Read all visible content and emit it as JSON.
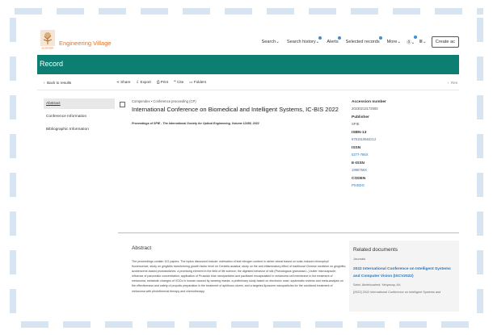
{
  "header": {
    "brand": "Engineering Village",
    "nav": [
      {
        "label": "Search",
        "chev": "⌄"
      },
      {
        "label": "Search history",
        "chev": "⌄",
        "dot": true
      },
      {
        "label": "Alerts",
        "chev": "",
        "dot": true
      },
      {
        "label": "Selected records",
        "chev": "",
        "dot": true
      },
      {
        "label": "More",
        "chev": "⌄"
      }
    ],
    "create_label": "Create ac"
  },
  "page_title": "Record",
  "toolbar": {
    "back": "Back to results",
    "actions": [
      {
        "icon": "share-icon",
        "glyph": "⋖",
        "label": "Share"
      },
      {
        "icon": "export-icon",
        "glyph": "⇩",
        "label": "Export"
      },
      {
        "icon": "print-icon",
        "glyph": "⎙",
        "label": "Print"
      },
      {
        "icon": "cite-icon",
        "glyph": "❞",
        "label": "Cite"
      },
      {
        "icon": "folder-icon",
        "glyph": "▭",
        "label": "Folders"
      }
    ],
    "next": "Res"
  },
  "sidebar": [
    "Abstract",
    "Conference Information",
    "Bibliographic Information"
  ],
  "record": {
    "breadcrumb": "Compendex • Conference proceeding (CP)",
    "title": "International Conference on Biomedical and Intelligent Systems, IC-BIS 2022",
    "proceedings": "Proceedings of SPIE - The International Society for Optical Engineering, Volume 12458, 2022"
  },
  "meta": [
    {
      "label": "Accession number",
      "value": "20230213172593",
      "link": false
    },
    {
      "label": "Publisher",
      "value": "SPIE",
      "link": false
    },
    {
      "label": "ISBN-13",
      "value": "9781510662212",
      "link": true
    },
    {
      "label": "ISSN",
      "value": "0277-786X",
      "link": true
    },
    {
      "label": "E-ISSN",
      "value": "1996756X",
      "link": true
    },
    {
      "label": "CODEN",
      "value": "PSISDG",
      "link": true
    }
  ],
  "abstract": {
    "heading": "Abstract",
    "text": "The proceedings contain 101 papers. The topics discussed include: estimation of leaf nitrogen content in winter wheat based on solar-induced chlorophyll fluorescence; study on gingivitis transforming growth factor level on Centella asiatica; study on the anti-inflammatory effect of traditional Chinese medicine on gingivitis; azobenzene-based photoswitches: a promising element in the field of life science; the digested behavior of silk (Pseudogaus granulosa L.) butter microcapsule; influence of pancreatin concentration; application of Prussian blue nanoparticles and paclitaxel encapsulated in melanoma cell membrane in the treatment of melanoma; metabolic changes of VOCs in human caused by wearing masks: a preliminary study based on electronic nose; systematic reviews and meta-analysis on the effectiveness and safety of propolis preparation in the treatment of aphthous ulcers; and a targeted liposome nanoparticles for the combined treatment of melanoma with photothermal therapy and chemotherapy."
  },
  "related": {
    "heading": "Related documents",
    "journals": "Journals",
    "doc_title": "2022 International Conference on Intelligent Systems and Computer Vision (ISCV2022)",
    "authors": "Sabri, Abdelouahed; Yahyaouy, Ali;",
    "source": "[2022] 2022 International Conference on Intelligent Systems and"
  },
  "colors": {
    "brand": "#e9711c",
    "bar": "#0c7e72",
    "link": "#2a74b8",
    "dot": "#3c8fd8"
  }
}
